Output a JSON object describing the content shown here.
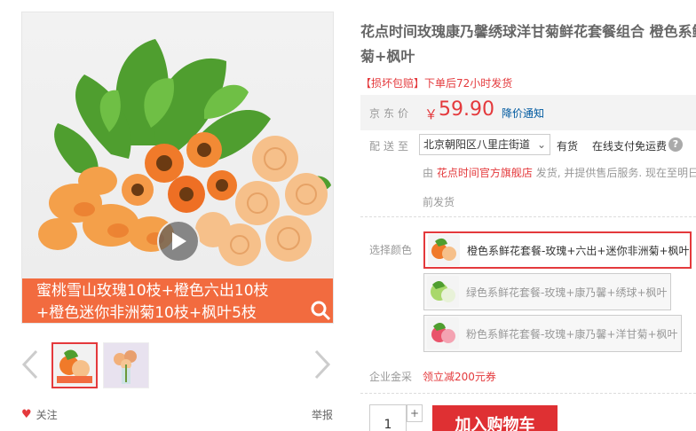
{
  "gallery": {
    "banner_line1": "蜜桃雪山玫瑰10枝+橙色六出10枝",
    "banner_line2": "+橙色迷你非洲菊10枝+枫叶5枝",
    "follow_label": "关注",
    "report_label": "举报"
  },
  "product": {
    "title_line1": "花点时间玫瑰康乃馨绣球洋甘菊鲜花套餐组合 橙色系鲜花套餐-玫瑰+六出+迷你非洲",
    "title_line2": "菊+枫叶",
    "promo": "【损坏包赔】下单后72小时发货"
  },
  "price": {
    "label": "京东价",
    "currency": "￥",
    "value": "59.90",
    "notify_label": "降价通知"
  },
  "delivery": {
    "label": "配送至",
    "address": "北京朝阳区八里庄街道",
    "stock": "有货",
    "shipping": "在线支付免运费",
    "seller_prefix": "由",
    "shop_name": "花点时间官方旗舰店",
    "seller_text": "发货, 并提供售后服务. 现在至明日",
    "seller_text2": "前发货"
  },
  "color": {
    "label": "选择颜色",
    "options": [
      {
        "label": "橙色系鲜花套餐-玫瑰+六出+迷你非洲菊+枫叶",
        "selected": true
      },
      {
        "label": "绿色系鲜花套餐-玫瑰+康乃馨+绣球+枫叶",
        "selected": false
      },
      {
        "label": "粉色系鲜花套餐-玫瑰+康乃馨+洋甘菊+枫叶",
        "selected": false
      }
    ]
  },
  "enterprise": {
    "label": "企业金采",
    "coupon": "领立减200元券"
  },
  "purchase": {
    "quantity": "1",
    "plus": "+",
    "add_to_cart": "加入购物车"
  },
  "colors": {
    "accent_red": "#e4393c",
    "banner_orange": "#f26b3f",
    "link_blue": "#005aa0"
  }
}
